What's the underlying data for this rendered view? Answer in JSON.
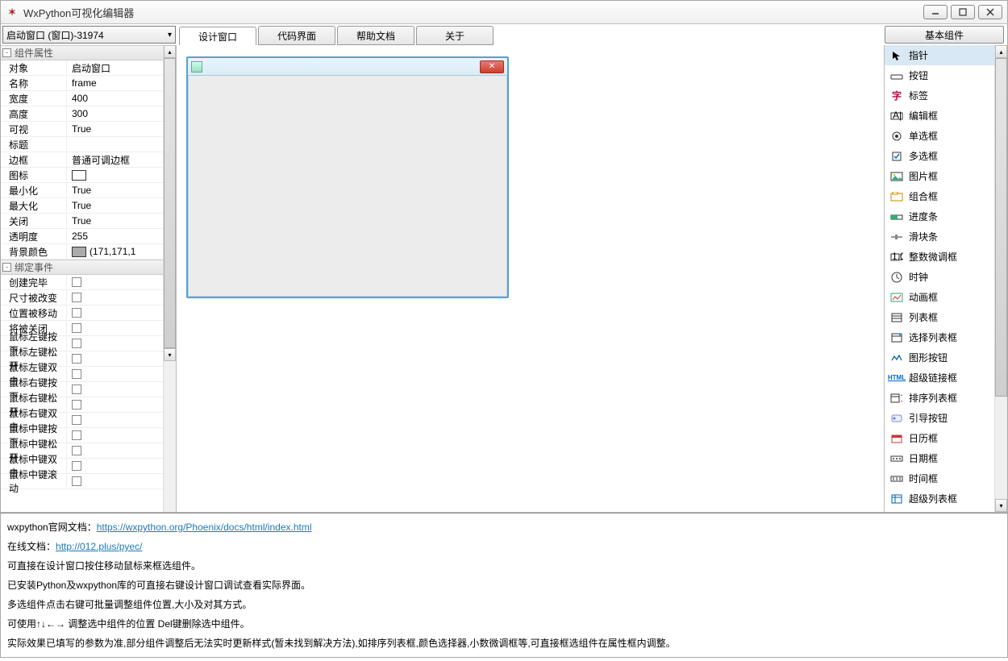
{
  "window": {
    "title": "WxPython可视化编辑器"
  },
  "selector": {
    "value": "启动窗口  (窗口)-31974"
  },
  "tabs": [
    {
      "label": "设计窗口",
      "active": true
    },
    {
      "label": "代码界面",
      "active": false
    },
    {
      "label": "帮助文档",
      "active": false
    },
    {
      "label": "关于",
      "active": false
    }
  ],
  "basic_btn": "基本组件",
  "propgrid": {
    "section1": "组件属性",
    "rows": [
      {
        "k": "对象",
        "v": "启动窗口"
      },
      {
        "k": "名称",
        "v": "frame"
      },
      {
        "k": "宽度",
        "v": "400"
      },
      {
        "k": "高度",
        "v": "300"
      },
      {
        "k": "可视",
        "v": "True"
      },
      {
        "k": "标题",
        "v": ""
      },
      {
        "k": "边框",
        "v": "普通可调边框"
      },
      {
        "k": "图标",
        "v": "",
        "icon": true
      },
      {
        "k": "最小化",
        "v": "True"
      },
      {
        "k": "最大化",
        "v": "True"
      },
      {
        "k": "关闭",
        "v": "True"
      },
      {
        "k": "透明度",
        "v": "255"
      },
      {
        "k": "背景颜色",
        "v": "(171,171,1",
        "color": "#ababab"
      }
    ],
    "section2": "绑定事件",
    "events": [
      "创建完毕",
      "尺寸被改变",
      "位置被移动",
      "将被关闭",
      "鼠标左键按下",
      "鼠标左键松开",
      "鼠标左键双击",
      "鼠标右键按下",
      "鼠标右键松开",
      "鼠标右键双击",
      "鼠标中键按下",
      "鼠标中键松开",
      "鼠标中键双击",
      "鼠标中键滚动"
    ]
  },
  "toolbox": [
    {
      "icon": "pointer",
      "label": "指针"
    },
    {
      "icon": "button",
      "label": "按钮"
    },
    {
      "icon": "label",
      "label": "标签"
    },
    {
      "icon": "edit",
      "label": "编辑框"
    },
    {
      "icon": "radio",
      "label": "单选框"
    },
    {
      "icon": "check",
      "label": "多选框"
    },
    {
      "icon": "image",
      "label": "图片框"
    },
    {
      "icon": "group",
      "label": "组合框"
    },
    {
      "icon": "progress",
      "label": "进度条"
    },
    {
      "icon": "slider",
      "label": "滑块条"
    },
    {
      "icon": "spin",
      "label": "整数微调框"
    },
    {
      "icon": "clock",
      "label": "时钟"
    },
    {
      "icon": "anim",
      "label": "动画框"
    },
    {
      "icon": "list",
      "label": "列表框"
    },
    {
      "icon": "choice",
      "label": "选择列表框"
    },
    {
      "icon": "imgbtn",
      "label": "图形按钮"
    },
    {
      "icon": "hyperlink",
      "label": "超级链接框"
    },
    {
      "icon": "sortlist",
      "label": "排序列表框"
    },
    {
      "icon": "guidebtn",
      "label": "引导按钮"
    },
    {
      "icon": "calendar",
      "label": "日历框"
    },
    {
      "icon": "date",
      "label": "日期框"
    },
    {
      "icon": "time",
      "label": "时间框"
    },
    {
      "icon": "superlist",
      "label": "超级列表框"
    }
  ],
  "help": {
    "l1_prefix": "wxpython官网文档：",
    "l1_link": "https://wxpython.org/Phoenix/docs/html/index.html",
    "l2_prefix": "在线文档：",
    "l2_link": "http://012.plus/pyec/",
    "l3": "可直接在设计窗口按住移动鼠标来框选组件。",
    "l4": "已安装Python及wxpython库的可直接右键设计窗口调试查看实际界面。",
    "l5": "多选组件点击右键可批量调整组件位置,大小及对其方式。",
    "l6": "可使用↑↓←→ 调整选中组件的位置 Del键删除选中组件。",
    "l7": "实际效果已填写的参数为准,部分组件调整后无法实时更新样式(暂未找到解决方法),如排序列表框,颜色选择器,小数微调框等,可直接框选组件在属性框内调整。"
  }
}
